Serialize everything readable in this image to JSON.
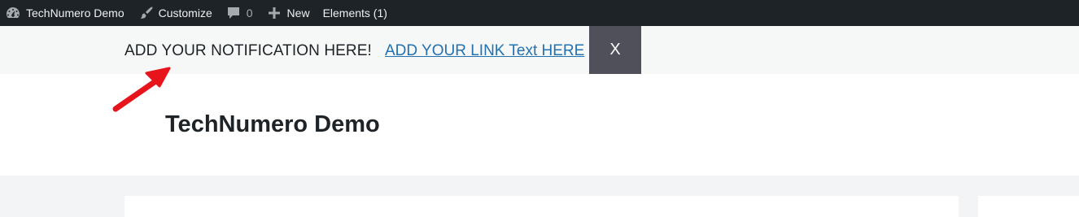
{
  "adminbar": {
    "site_name": "TechNumero Demo",
    "customize": "Customize",
    "comments_count": "0",
    "new_label": "New",
    "elements_label": "Elements (1)",
    "icons": [
      "dashboard-icon",
      "brush-icon",
      "comment-icon",
      "plus-icon"
    ]
  },
  "notification": {
    "text": "ADD YOUR NOTIFICATION HERE!",
    "link_text": "ADD YOUR LINK Text HERE",
    "close_label": "X",
    "close_bg": "#50505a",
    "link_color": "#2271b1"
  },
  "header": {
    "site_title": "TechNumero Demo"
  },
  "annotation": {
    "arrow_color": "#e8141c"
  }
}
